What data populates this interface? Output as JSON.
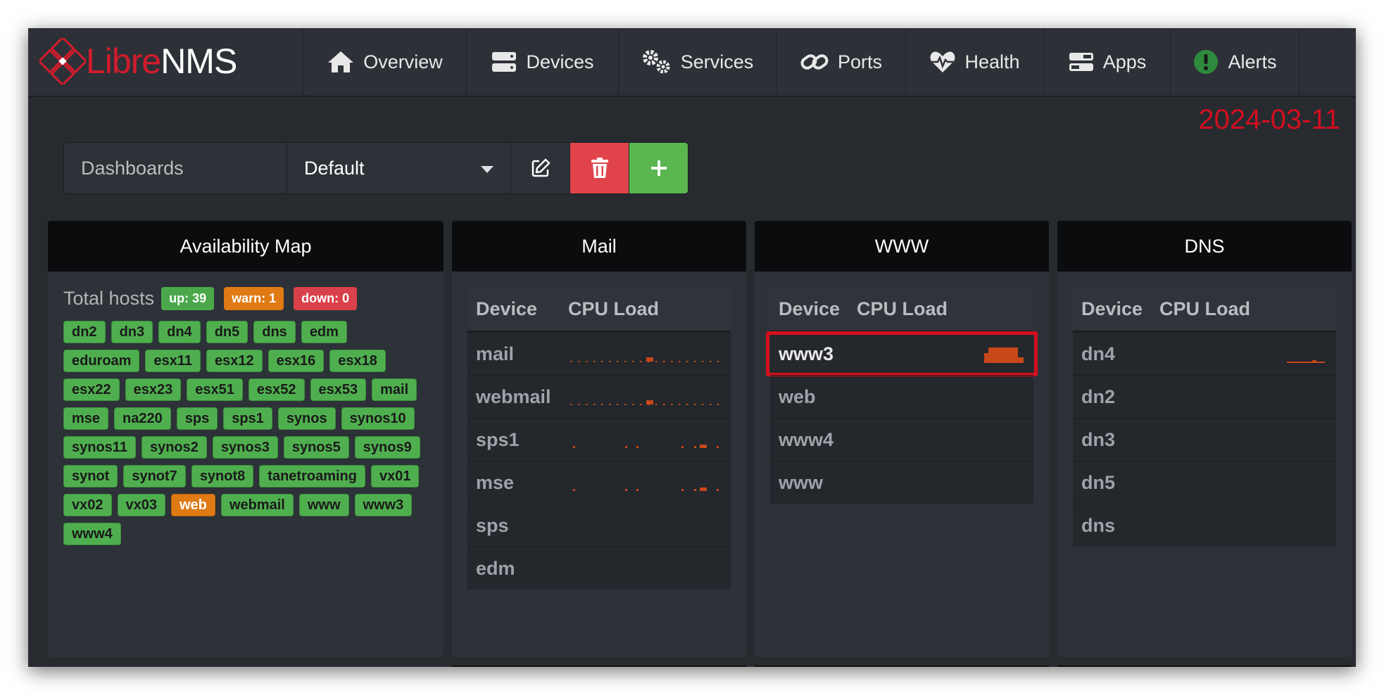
{
  "brand": {
    "part1": "Libre",
    "part2": "NMS"
  },
  "nav": [
    {
      "label": "Overview",
      "icon": "home-icon"
    },
    {
      "label": "Devices",
      "icon": "server-icon"
    },
    {
      "label": "Services",
      "icon": "cogs-icon"
    },
    {
      "label": "Ports",
      "icon": "link-icon"
    },
    {
      "label": "Health",
      "icon": "heartbeat-icon"
    },
    {
      "label": "Apps",
      "icon": "tasks-icon"
    },
    {
      "label": "Alerts",
      "icon": "alert-icon"
    }
  ],
  "date": "2024-03-11",
  "dashboards": {
    "label": "Dashboards",
    "selected": "Default"
  },
  "availability": {
    "title": "Availability Map",
    "total_label": "Total hosts",
    "up": "up: 39",
    "warn": "warn: 1",
    "down": "down: 0",
    "hosts": [
      {
        "name": "dn2",
        "status": "up"
      },
      {
        "name": "dn3",
        "status": "up"
      },
      {
        "name": "dn4",
        "status": "up"
      },
      {
        "name": "dn5",
        "status": "up"
      },
      {
        "name": "dns",
        "status": "up"
      },
      {
        "name": "edm",
        "status": "up"
      },
      {
        "name": "eduroam",
        "status": "up"
      },
      {
        "name": "esx11",
        "status": "up"
      },
      {
        "name": "esx12",
        "status": "up"
      },
      {
        "name": "esx16",
        "status": "up"
      },
      {
        "name": "esx18",
        "status": "up"
      },
      {
        "name": "esx22",
        "status": "up"
      },
      {
        "name": "esx23",
        "status": "up"
      },
      {
        "name": "esx51",
        "status": "up"
      },
      {
        "name": "esx52",
        "status": "up"
      },
      {
        "name": "esx53",
        "status": "up"
      },
      {
        "name": "mail",
        "status": "up"
      },
      {
        "name": "mse",
        "status": "up"
      },
      {
        "name": "na220",
        "status": "up"
      },
      {
        "name": "sps",
        "status": "up"
      },
      {
        "name": "sps1",
        "status": "up"
      },
      {
        "name": "synos",
        "status": "up"
      },
      {
        "name": "synos10",
        "status": "up"
      },
      {
        "name": "synos11",
        "status": "up"
      },
      {
        "name": "synos2",
        "status": "up"
      },
      {
        "name": "synos3",
        "status": "up"
      },
      {
        "name": "synos5",
        "status": "up"
      },
      {
        "name": "synos9",
        "status": "up"
      },
      {
        "name": "synot",
        "status": "up"
      },
      {
        "name": "synot7",
        "status": "up"
      },
      {
        "name": "synot8",
        "status": "up"
      },
      {
        "name": "tanetroaming",
        "status": "up"
      },
      {
        "name": "vx01",
        "status": "up"
      },
      {
        "name": "vx02",
        "status": "up"
      },
      {
        "name": "vx03",
        "status": "up"
      },
      {
        "name": "web",
        "status": "warn"
      },
      {
        "name": "webmail",
        "status": "up"
      },
      {
        "name": "www",
        "status": "up"
      },
      {
        "name": "www3",
        "status": "up"
      },
      {
        "name": "www4",
        "status": "up"
      }
    ]
  },
  "widgets": [
    {
      "title": "Mail",
      "col_device": "Device",
      "col_cpu": "CPU Load",
      "rows": [
        {
          "name": "mail",
          "spark": "dotted"
        },
        {
          "name": "webmail",
          "spark": "dotted"
        },
        {
          "name": "sps1",
          "spark": "sparse"
        },
        {
          "name": "mse",
          "spark": "sparse"
        },
        {
          "name": "sps",
          "spark": "none"
        },
        {
          "name": "edm",
          "spark": "none"
        }
      ]
    },
    {
      "title": "WWW",
      "col_device": "Device",
      "col_cpu": "CPU Load",
      "rows": [
        {
          "name": "www3",
          "spark": "block",
          "highlight": true
        },
        {
          "name": "web",
          "spark": "none"
        },
        {
          "name": "www4",
          "spark": "none"
        },
        {
          "name": "www",
          "spark": "none"
        }
      ]
    },
    {
      "title": "DNS",
      "col_device": "Device",
      "col_cpu": "CPU Load",
      "rows": [
        {
          "name": "dn4",
          "spark": "line"
        },
        {
          "name": "dn2",
          "spark": "none"
        },
        {
          "name": "dn3",
          "spark": "none"
        },
        {
          "name": "dn5",
          "spark": "none"
        },
        {
          "name": "dns",
          "spark": "none"
        }
      ]
    }
  ],
  "colors": {
    "accent_red": "#d21c2c",
    "up_green": "#4faf4f",
    "warn_orange": "#e07a14",
    "down_red": "#d9414a",
    "spark_orange": "#c8481a"
  }
}
